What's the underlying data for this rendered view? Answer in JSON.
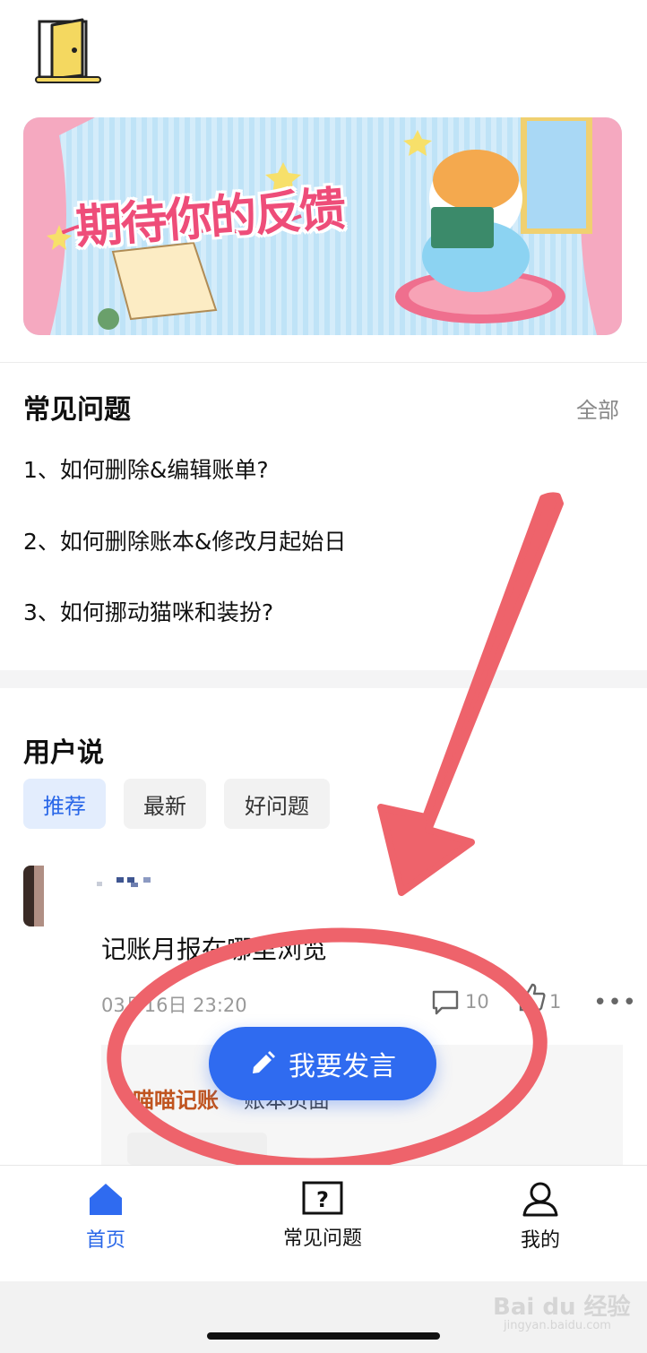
{
  "banner": {
    "title": "期待你的反馈"
  },
  "faq": {
    "heading": "常见问题",
    "all_label": "全部",
    "items": [
      "1、如何删除&编辑账单?",
      "2、如何删除账本&修改月起始日",
      "3、如何挪动猫咪和装扮?"
    ]
  },
  "users": {
    "heading": "用户说",
    "chips": [
      "推荐",
      "最新",
      "好问题"
    ],
    "post": {
      "title": "记账月报在哪里浏览",
      "time": "03月16日 23:20",
      "comments": "10",
      "likes": "1",
      "quote_brand": "喵喵记账",
      "quote_sub": "账本页面"
    }
  },
  "fab": {
    "label": "我要发言"
  },
  "tabs": [
    {
      "label": "首页",
      "icon": "home-icon"
    },
    {
      "label": "常见问题",
      "icon": "question-icon"
    },
    {
      "label": "我的",
      "icon": "user-icon"
    }
  ],
  "watermark": {
    "brand": "Bai du 经验",
    "url": "jingyan.baidu.com"
  },
  "colors": {
    "accent": "#2f6bf0",
    "annotation": "#ee636b"
  }
}
